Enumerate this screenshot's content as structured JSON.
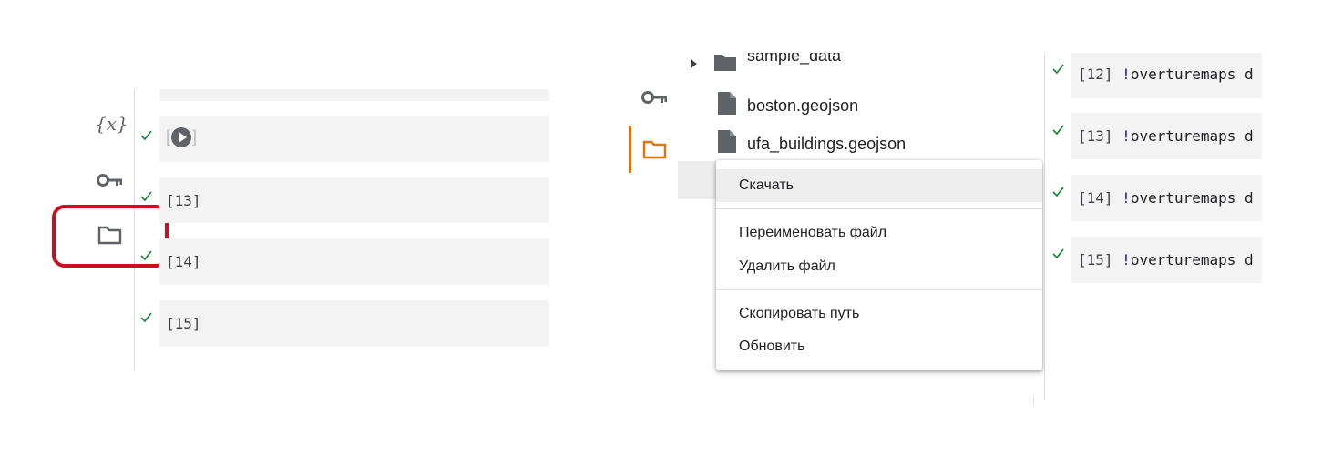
{
  "left_panel": {
    "sidebar_icons": [
      "variables-icon",
      "key-icon",
      "folder-icon"
    ],
    "variables_icon_text": "{x}",
    "cells": [
      {
        "number": "",
        "status": "done",
        "running": true,
        "bracket_open": "[",
        "bracket_close": "]"
      },
      {
        "number": "[13]",
        "status": "done"
      },
      {
        "number": "[14]",
        "status": "done"
      },
      {
        "number": "[15]",
        "status": "done"
      }
    ],
    "highlight_color": "#cc0c1f"
  },
  "right_panel": {
    "files": [
      {
        "name": "sample_data",
        "type": "folder"
      },
      {
        "name": "boston.geojson",
        "type": "file"
      },
      {
        "name": "ufa_buildings.geojson",
        "type": "file"
      }
    ],
    "context_menu": {
      "items": [
        {
          "label": "Скачать",
          "hovered": true
        },
        {
          "label": "Переименовать файл"
        },
        {
          "label": "Удалить файл"
        },
        {
          "label": "Скопировать путь"
        },
        {
          "label": "Обновить"
        }
      ]
    },
    "code_cells": [
      {
        "number": "[12]",
        "bang": "!",
        "command": "overturemaps d"
      },
      {
        "number": "[13]",
        "bang": "!",
        "command": "overturemaps d"
      },
      {
        "number": "[14]",
        "bang": "!",
        "command": "overturemaps d"
      },
      {
        "number": "[15]",
        "bang": "!",
        "command": "overturemaps d"
      }
    ],
    "accent_color": "#e37400"
  },
  "colors": {
    "check": "#188038",
    "cell_background": "#f3f3f3",
    "bang": "#1a1aa6"
  }
}
